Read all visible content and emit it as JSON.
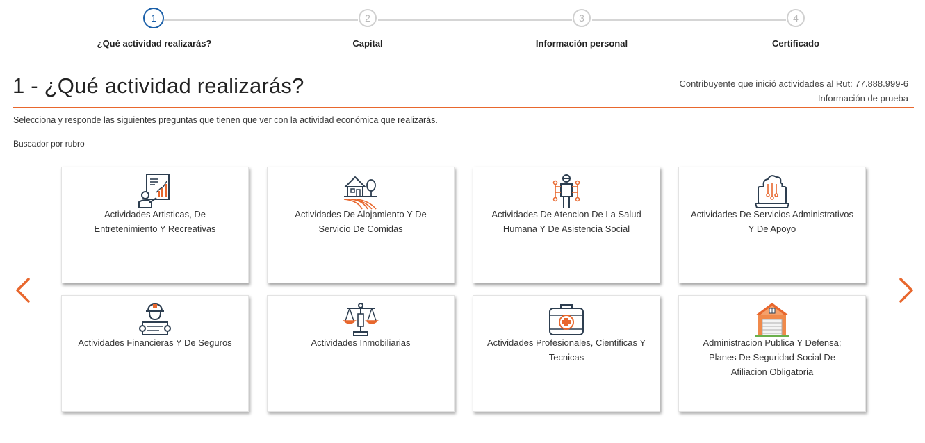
{
  "stepper": {
    "steps": [
      {
        "number": "1",
        "label": "¿Qué actividad realizarás?"
      },
      {
        "number": "2",
        "label": "Capital"
      },
      {
        "number": "3",
        "label": "Información personal"
      },
      {
        "number": "4",
        "label": "Certificado"
      }
    ],
    "active_step": 1
  },
  "header": {
    "title": "1 - ¿Qué actividad realizarás?",
    "rut_text": "Contribuyente que inició actividades al Rut: 77.888.999-6",
    "info_text": "Información de prueba"
  },
  "main": {
    "description": "Selecciona y responde las siguientes preguntas que tienen que ver con la actividad económica que realizarás.",
    "search_label": "Buscador por rubro",
    "cards": [
      {
        "label": "Actividades Artisticas, De Entretenimiento Y Recreativas",
        "icon": "presentation-chart-icon"
      },
      {
        "label": "Actividades De Alojamiento Y De Servicio De Comidas",
        "icon": "farm-house-icon"
      },
      {
        "label": "Actividades De Atencion De La Salud Humana Y De Asistencia Social",
        "icon": "worker-network-icon"
      },
      {
        "label": "Actividades De Servicios Administrativos Y De Apoyo",
        "icon": "laptop-cloud-icon"
      },
      {
        "label": "Actividades Financieras Y De Seguros",
        "icon": "engineer-blueprint-icon"
      },
      {
        "label": "Actividades Inmobiliarias",
        "icon": "scales-justice-icon"
      },
      {
        "label": "Actividades Profesionales, Cientificas Y Tecnicas",
        "icon": "medical-kit-icon"
      },
      {
        "label": "Administracion Publica Y Defensa; Planes De Seguridad Social De Afiliacion Obligatoria",
        "icon": "garage-house-icon"
      }
    ]
  },
  "colors": {
    "accent": "#e8672d",
    "active_step": "#1a5fa8",
    "icon_stroke": "#2d3e50"
  },
  "nav": {
    "prev_icon": "chevron-left-icon",
    "next_icon": "chevron-right-icon"
  }
}
